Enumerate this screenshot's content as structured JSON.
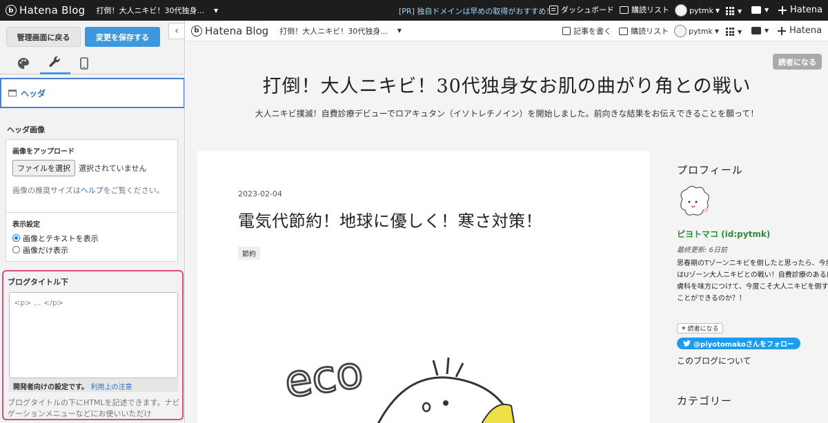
{
  "topbar": {
    "brand": "Hatena Blog",
    "blog_name": "打倒！大人ニキビ！30代独身...",
    "pr_tag": "[PR]",
    "pr_text": "独自ドメインは早めの取得がおすすめ！",
    "dashboard": "ダッシュボード",
    "subscriptions": "購読リスト",
    "user": "pytmk",
    "hatena": "Hatena"
  },
  "panel": {
    "back_button": "管理画面に戻る",
    "save_button": "変更を保存する",
    "collapse": "‹",
    "section": "ヘッダ",
    "header_image_title": "ヘッダ画像",
    "upload_label": "画像をアップロード",
    "file_button": "ファイルを選択",
    "file_status": "選択されていません",
    "recommend_prefix": "画像の推奨サイズは",
    "recommend_link": "ヘルプ",
    "recommend_suffix": "をご覧ください。",
    "display_title": "表示設定",
    "option_both": "画像とテキストを表示",
    "option_image": "画像だけ表示",
    "under_title_label": "ブログタイトル下",
    "textarea_placeholder": "<p> ... </p>",
    "dev_note": "開発者向けの設定です。",
    "dev_link": "利用上の注意",
    "description": "ブログタイトルの下にHTMLを記述できます。ナビゲーションメニューなどにお使いいただけ"
  },
  "blogbar": {
    "brand": "Hatena Blog",
    "blog_name": "打倒！大人ニキビ！30代独身...",
    "write": "記事を書く",
    "subscriptions": "購読リスト",
    "user": "pytmk",
    "hatena": "Hatena"
  },
  "blog": {
    "reader_button": "読者になる",
    "title": "打倒！大人ニキビ！30代独身女お肌の曲がり角との戦い",
    "description": "大人ニキビ撲滅！自費診療デビューでロアキュタン（イソトレチノイン）を開始しました。前向きな結果をお伝えできることを願って！",
    "entry_date": "2023-02-04",
    "entry_title": "電気代節約！地球に優しく！寒さ対策！",
    "entry_category": "節約",
    "image_text": "eco"
  },
  "sidebar": {
    "profile_heading": "プロフィール",
    "name": "ピヨトマコ (id:pytmk)",
    "updated": "最終更新: 6日前",
    "bio": "思春期のTゾーンニキビを倒したと思ったら、今度はUゾーン大人ニキビとの戦い！自費診療のある皮膚科を味方につけて、今度こそ大人ニキビを倒すことができるのか？！",
    "reader_button": "読者になる",
    "twitter_button": "@piyotomakoさんをフォロー",
    "about": "このブログについて",
    "category_heading": "カテゴリー"
  },
  "colors": {
    "accent": "#3f97de",
    "highlight_border": "#d94a87",
    "topbar": "#1d1d1d",
    "profile_name": "#2e8b3a",
    "twitter": "#1d9bf0"
  }
}
